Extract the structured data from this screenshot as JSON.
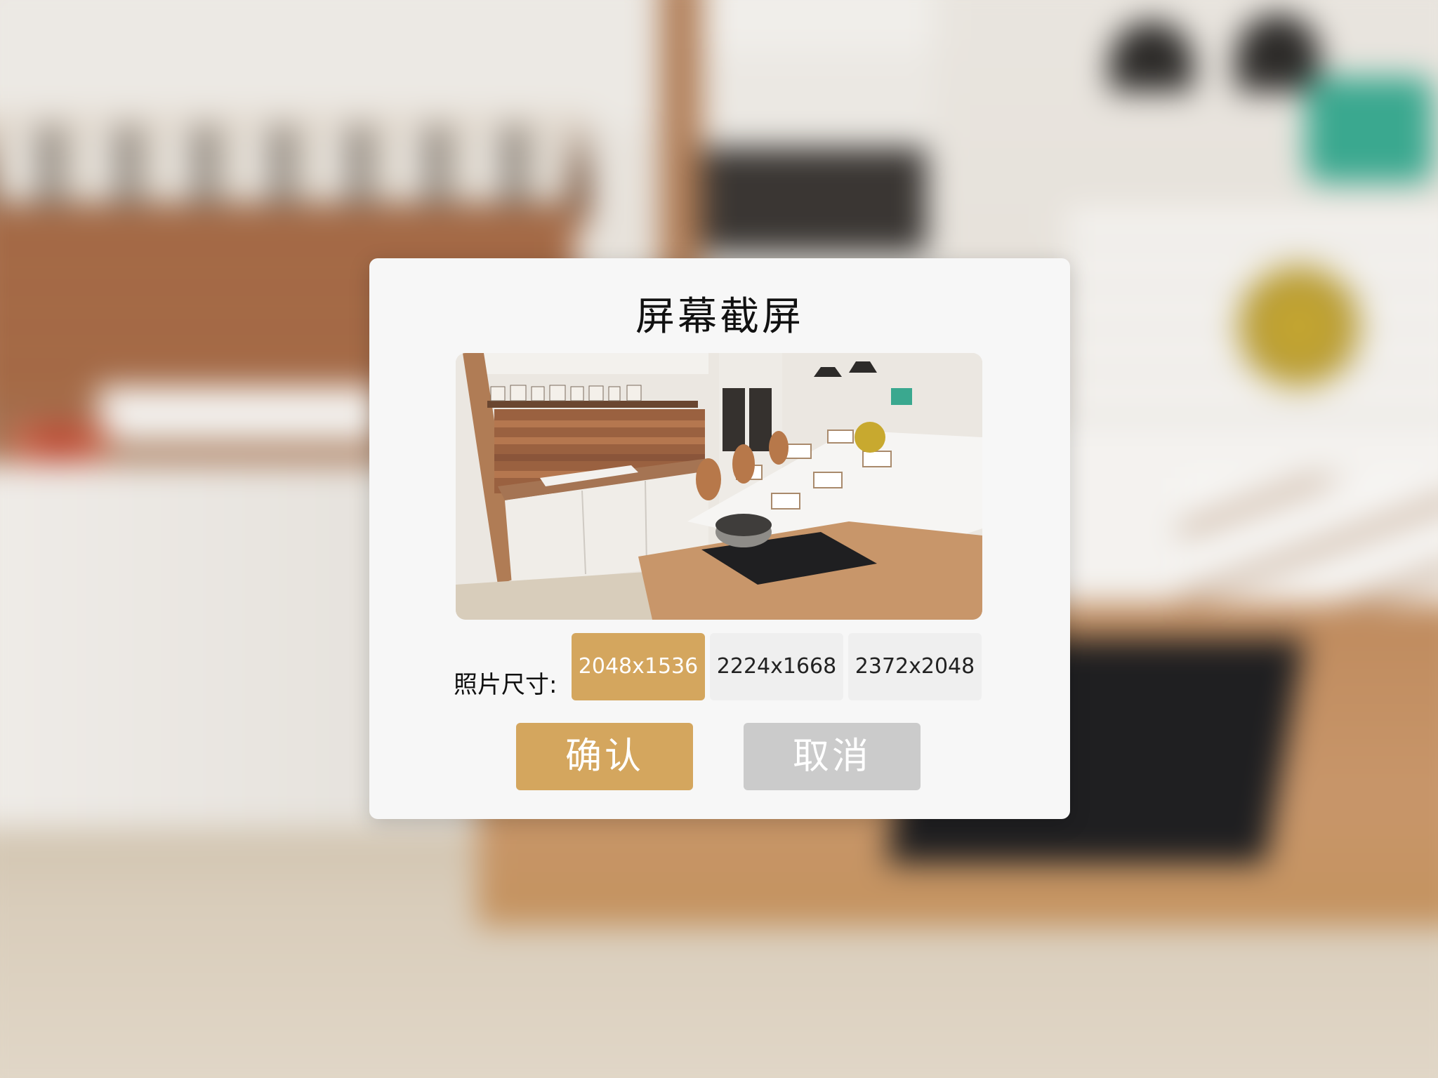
{
  "dialog": {
    "title": "屏幕截屏",
    "size_label": "照片尺寸:",
    "size_options": [
      {
        "label": "2048x1536",
        "selected": true
      },
      {
        "label": "2224x1668",
        "selected": false
      },
      {
        "label": "2372x2048",
        "selected": false
      }
    ],
    "confirm_label": "确认",
    "cancel_label": "取消"
  },
  "colors": {
    "accent": "#d4a65e",
    "cancel_bg": "#cbcbcb",
    "option_bg": "#efefef",
    "dialog_bg": "#f7f7f7"
  }
}
